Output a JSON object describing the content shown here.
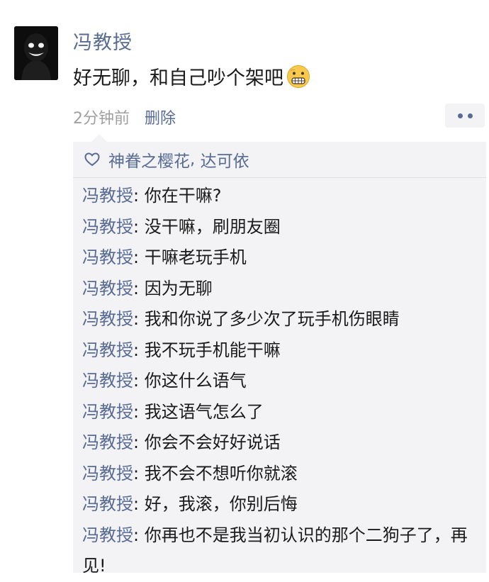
{
  "post": {
    "author": "冯教授",
    "text": "好无聊，和自己吵个架吧",
    "emoji": "grimacing-face-emoji",
    "time": "2分钟前",
    "delete_label": "删除"
  },
  "likes": {
    "icon": "heart-icon",
    "names": [
      "神眷之樱花",
      "达可依"
    ],
    "separator": ", "
  },
  "comments": [
    {
      "author": "冯教授",
      "text": "你在干嘛?"
    },
    {
      "author": "冯教授",
      "text": "没干嘛，刷朋友圈"
    },
    {
      "author": "冯教授",
      "text": "干嘛老玩手机"
    },
    {
      "author": "冯教授",
      "text": "因为无聊"
    },
    {
      "author": "冯教授",
      "text": "我和你说了多少次了玩手机伤眼睛"
    },
    {
      "author": "冯教授",
      "text": "我不玩手机能干嘛"
    },
    {
      "author": "冯教授",
      "text": "你这什么语气"
    },
    {
      "author": "冯教授",
      "text": "我这语气怎么了"
    },
    {
      "author": "冯教授",
      "text": "你会不会好好说话"
    },
    {
      "author": "冯教授",
      "text": "我不会不想听你就滚"
    },
    {
      "author": "冯教授",
      "text": "好，我滚，你别后悔"
    },
    {
      "author": "冯教授",
      "text": "你再也不是我当初认识的那个二狗子了，再见!"
    }
  ],
  "colors": {
    "link": "#576b95",
    "text": "#1a1a1a",
    "meta": "#a0a0a0",
    "panel": "#f3f3f5"
  }
}
